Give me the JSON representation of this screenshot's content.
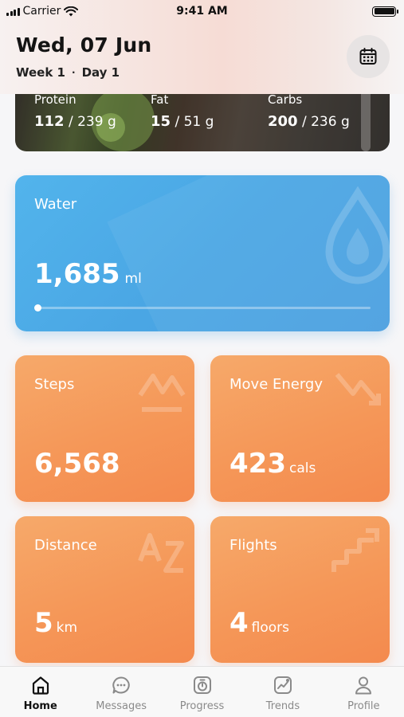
{
  "status_bar": {
    "carrier": "Carrier",
    "time": "9:41 AM"
  },
  "header": {
    "date": "Wed, 07 Jun",
    "week": "Week 1",
    "separator": "·",
    "day": "Day 1",
    "calendar_icon": "calendar-icon"
  },
  "macros": [
    {
      "label": "Protein",
      "value": "112",
      "total": "/ 239 g"
    },
    {
      "label": "Fat",
      "value": "15",
      "total": "/ 51 g"
    },
    {
      "label": "Carbs",
      "value": "200",
      "total": "/ 236 g"
    }
  ],
  "water": {
    "title": "Water",
    "value": "1,685",
    "unit": "ml",
    "progress": 0.0,
    "icon": "water-drop-icon",
    "color": "#4aa6e4"
  },
  "activity": {
    "accent_color": "#f59758",
    "steps": {
      "title": "Steps",
      "value": "6,568",
      "unit": "",
      "icon": "steps-icon"
    },
    "move_energy": {
      "title": "Move Energy",
      "value": "423",
      "unit": "cals",
      "icon": "lightning-icon"
    },
    "distance": {
      "title": "Distance",
      "value": "5",
      "unit": "km",
      "icon": "distance-icon"
    },
    "flights": {
      "title": "Flights",
      "value": "4",
      "unit": "floors",
      "icon": "stairs-icon"
    }
  },
  "tabs": [
    {
      "label": "Home",
      "icon": "home-icon",
      "active": true
    },
    {
      "label": "Messages",
      "icon": "messages-icon",
      "active": false
    },
    {
      "label": "Progress",
      "icon": "progress-icon",
      "active": false
    },
    {
      "label": "Trends",
      "icon": "trends-icon",
      "active": false
    },
    {
      "label": "Profile",
      "icon": "profile-icon",
      "active": false
    }
  ]
}
